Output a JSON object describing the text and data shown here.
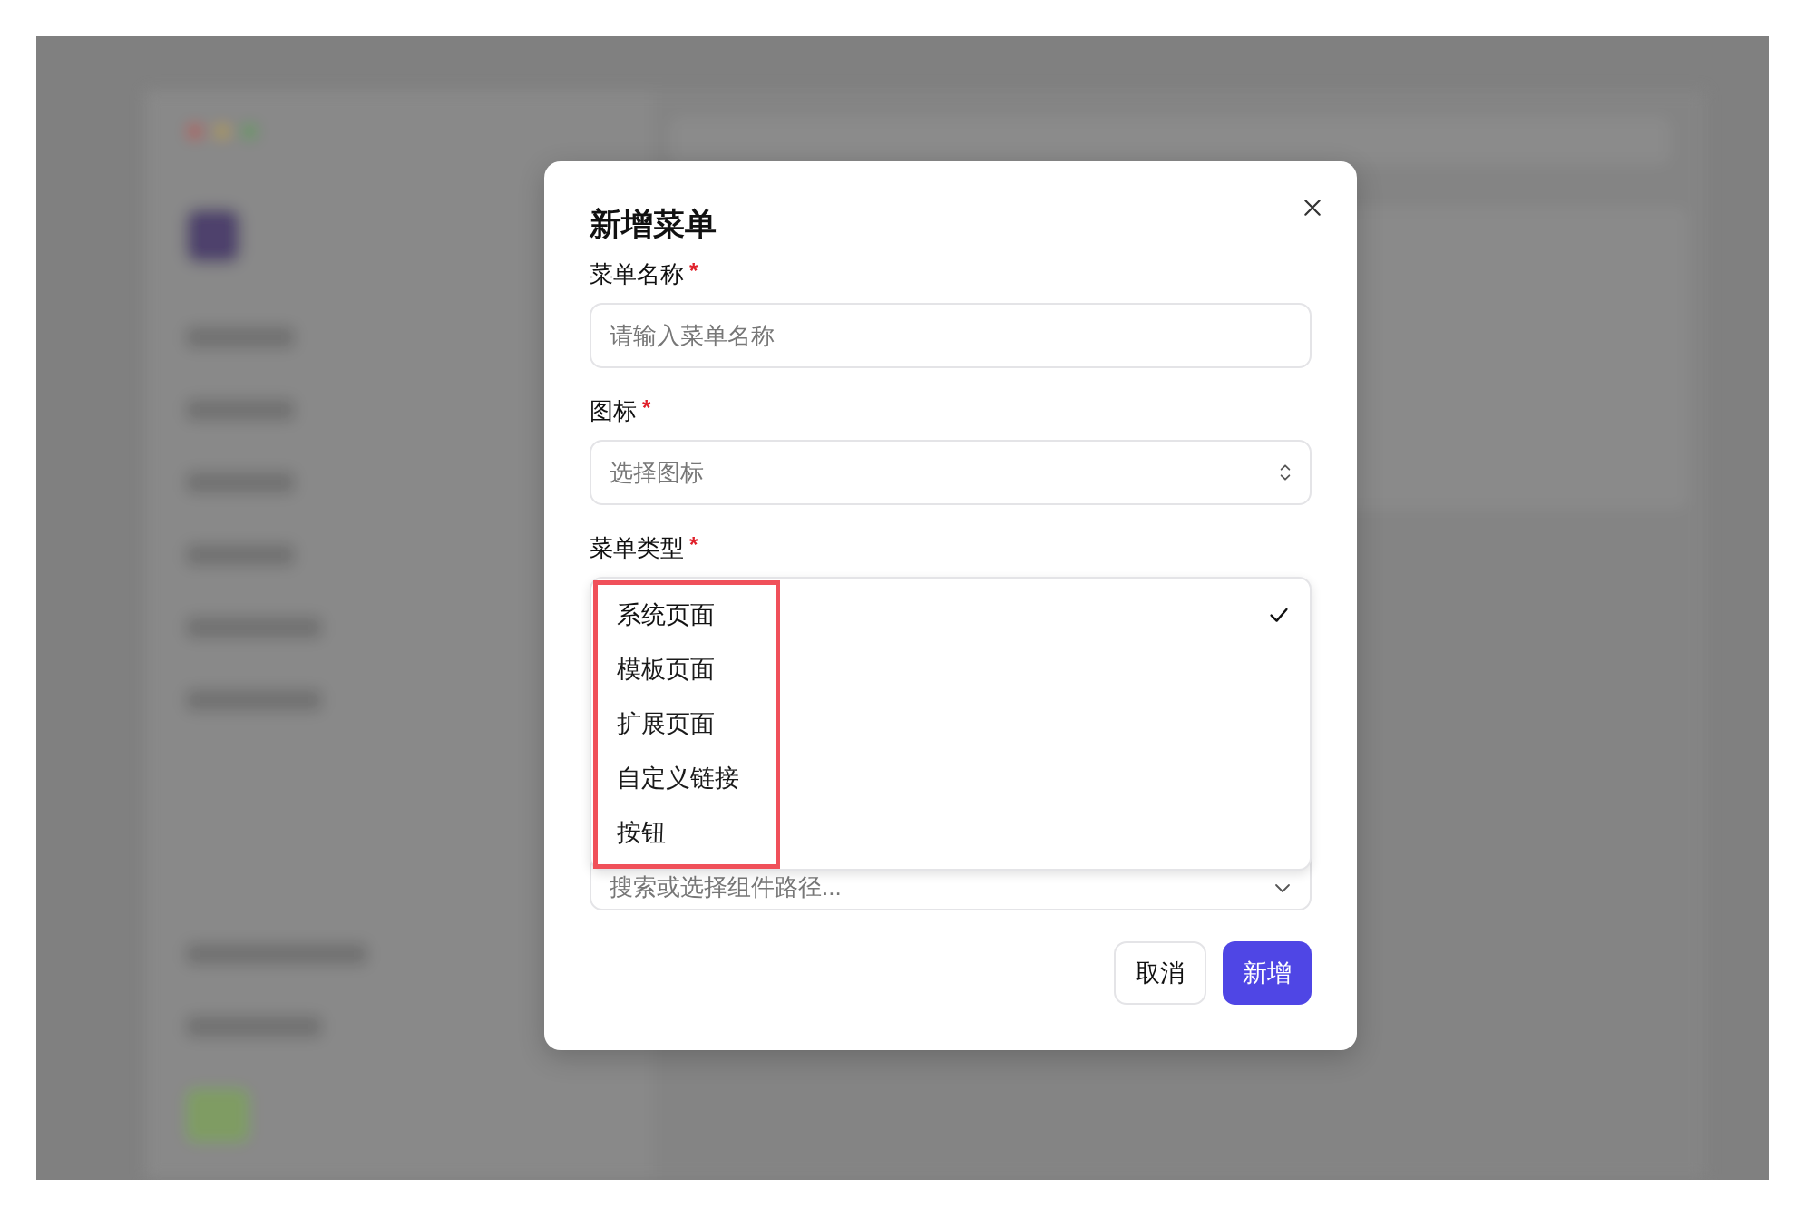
{
  "dialog": {
    "title": "新增菜单",
    "fields": [
      {
        "kind": "input",
        "label": "菜单名称",
        "mark": "*",
        "placeholder": "请输入菜单名称"
      },
      {
        "kind": "select",
        "label": "图标",
        "mark": "*",
        "placeholder": "选择图标"
      },
      {
        "kind": "label",
        "label": "菜单类型",
        "mark": "*"
      }
    ],
    "dropdown": {
      "options": [
        {
          "label": "系统页面",
          "selected": true
        },
        {
          "label": "模板页面",
          "selected": false
        },
        {
          "label": "扩展页面",
          "selected": false
        },
        {
          "label": "自定义链接",
          "selected": false
        },
        {
          "label": "按钮",
          "selected": false
        }
      ],
      "annotation_box": true
    },
    "component_field": {
      "placeholder": "搜索或选择组件路径..."
    },
    "buttons": [
      {
        "label": "取消",
        "kind": "secondary"
      },
      {
        "label": "新增",
        "kind": "primary"
      }
    ]
  }
}
